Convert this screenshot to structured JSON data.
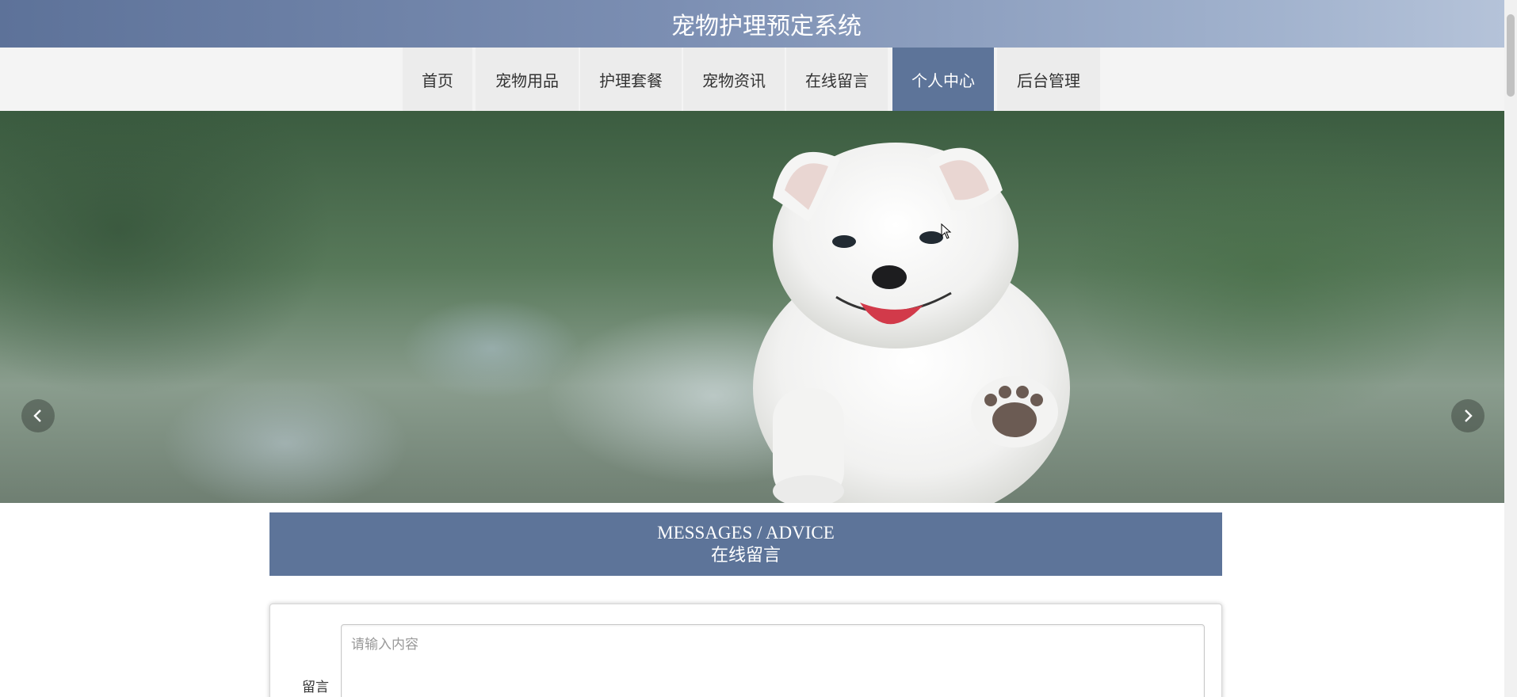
{
  "header": {
    "title": "宠物护理预定系统"
  },
  "nav": {
    "items": [
      {
        "label": "首页"
      },
      {
        "label": "宠物用品"
      },
      {
        "label": "护理套餐"
      },
      {
        "label": "宠物资讯"
      },
      {
        "label": "在线留言"
      },
      {
        "label": "个人中心",
        "active": true
      },
      {
        "label": "后台管理"
      }
    ]
  },
  "carousel": {
    "image": "white-samoyed-puppy",
    "prev_icon": "chevron-left-icon",
    "next_icon": "chevron-right-icon"
  },
  "section": {
    "title_en": "MESSAGES / ADVICE",
    "title_zh": "在线留言"
  },
  "form": {
    "message_label": "留言",
    "message_placeholder": "请输入内容",
    "message_value": ""
  },
  "colors": {
    "primary": "#5d7499",
    "nav_bg": "#f4f4f4",
    "nav_item_bg": "#ececec"
  }
}
